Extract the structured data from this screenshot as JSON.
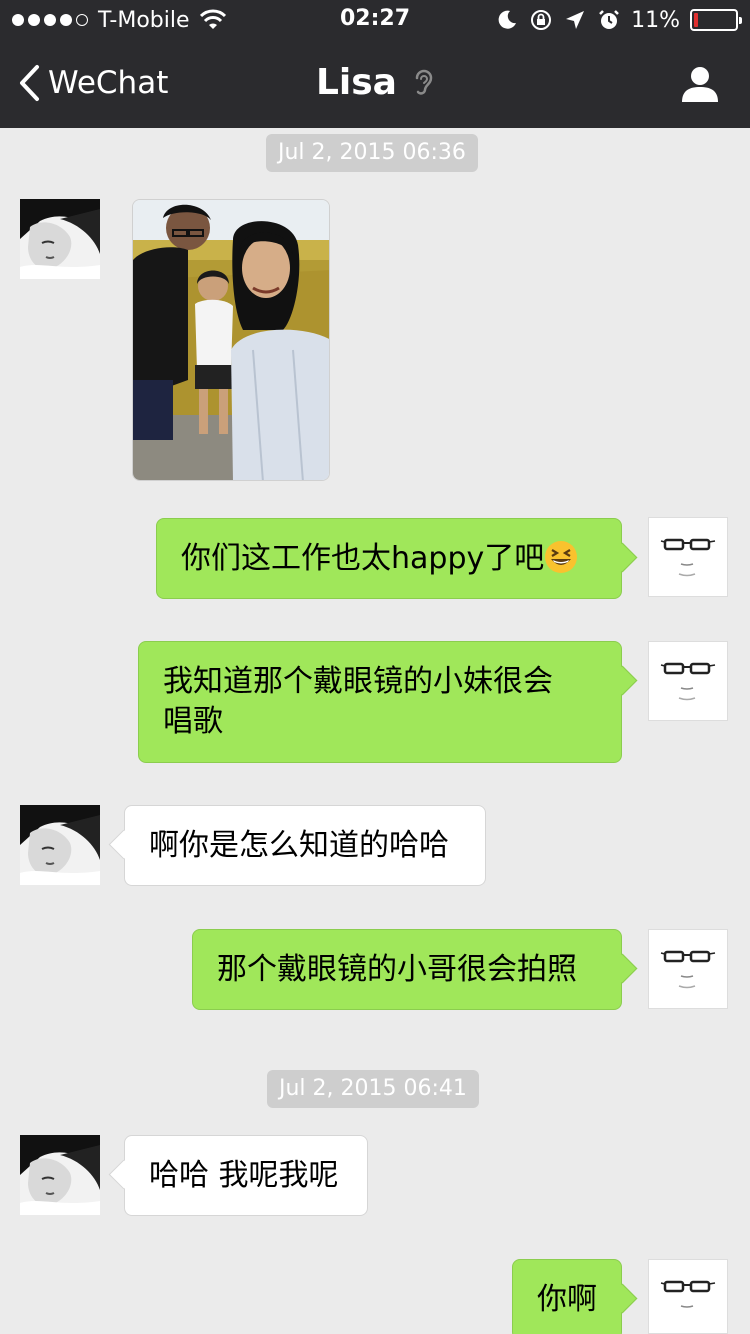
{
  "status_bar": {
    "signal_dots": 5,
    "signal_filled": 4,
    "carrier": "T-Mobile",
    "time": "02:27",
    "battery_percent": "11%",
    "battery_level": 0.11,
    "icons": [
      "wifi-icon",
      "moon-icon",
      "rotation-lock-icon",
      "location-arrow-icon",
      "alarm-icon",
      "battery-icon"
    ]
  },
  "nav": {
    "back_label": "WeChat",
    "title": "Lisa",
    "icons": [
      "back-chevron-icon",
      "earpiece-mode-icon",
      "contact-profile-icon"
    ]
  },
  "chat": {
    "timestamps": [
      "Jul 2, 2015 06:36",
      "Jul 2, 2015 06:41"
    ],
    "messages": [
      {
        "from": "Lisa",
        "type": "image",
        "alt": ""
      },
      {
        "from": "me",
        "type": "text",
        "text": "你们这工作也太happy了吧",
        "emoji": "grinning-squinting-face"
      },
      {
        "from": "me",
        "type": "text",
        "text_line1": "我知道那个戴眼镜的小妹很会",
        "text_line2": "唱歌"
      },
      {
        "from": "Lisa",
        "type": "text",
        "text": "啊你是怎么知道的哈哈"
      },
      {
        "from": "me",
        "type": "text",
        "text": "那个戴眼镜的小哥很会拍照"
      },
      {
        "from": "Lisa",
        "type": "text",
        "text": "哈哈 我呢我呢"
      },
      {
        "from": "me",
        "type": "text",
        "text": "你啊"
      }
    ]
  },
  "colors": {
    "header_bg": "#2b2b2e",
    "chat_bg": "#ebebeb",
    "outgoing_bubble": "#a0e75a",
    "incoming_bubble": "#ffffff",
    "timestamp_bg": "#cecece",
    "battery_low": "#e03030"
  }
}
